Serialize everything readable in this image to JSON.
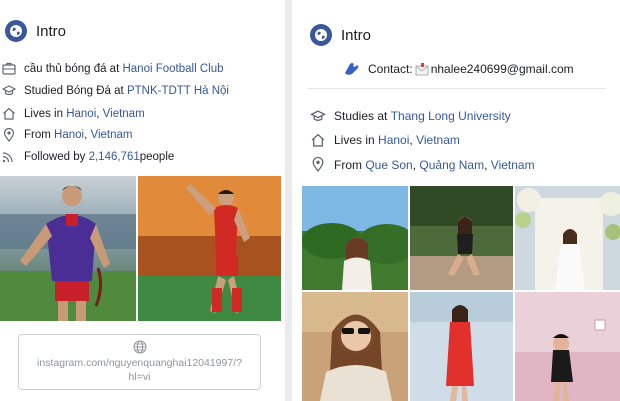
{
  "left": {
    "intro_title": "Intro",
    "work": {
      "prefix": "cầu thủ bóng đá at ",
      "link": "Hanoi Football Club"
    },
    "studied": {
      "prefix": "Studied Bóng Đá at ",
      "link": "PTNK-TDTT Hà Nội"
    },
    "lives": {
      "prefix": "Lives in ",
      "city": "Hanoi",
      "sep": ", ",
      "country": "Vietnam"
    },
    "from": {
      "prefix": "From ",
      "city": "Hanoi",
      "sep": ", ",
      "country": "Vietnam"
    },
    "followed": {
      "prefix": "Followed by ",
      "count": "2,146,761",
      "suffix": " people"
    },
    "instagram": {
      "line1": "instagram.com/nguyenquanghai12041997/?",
      "line2": "hl=vi"
    }
  },
  "right": {
    "intro_title": "Intro",
    "contact": {
      "label": "Contact:",
      "email": "nhalee240699@gmail.com"
    },
    "studies": {
      "prefix": "Studies at ",
      "link": "Thang Long University"
    },
    "lives": {
      "prefix": "Lives in ",
      "city": "Hanoi",
      "sep": ", ",
      "country": "Vietnam"
    },
    "from": {
      "prefix": "From ",
      "town": "Que Son",
      "sep1": ", ",
      "province": "Quảng Nam",
      "sep2": ", ",
      "country": "Vietnam"
    }
  },
  "colors": {
    "link": "#365899",
    "icon": "#606770",
    "globe": "#3b5998",
    "panel_bg": "#ffffff",
    "page_bg": "#e9ebee"
  },
  "icons": [
    "globe-icon",
    "briefcase-icon",
    "graduation-cap-icon",
    "home-icon",
    "location-pin-icon",
    "rss-icon",
    "web-icon",
    "phone-icon",
    "envelope-icon"
  ]
}
